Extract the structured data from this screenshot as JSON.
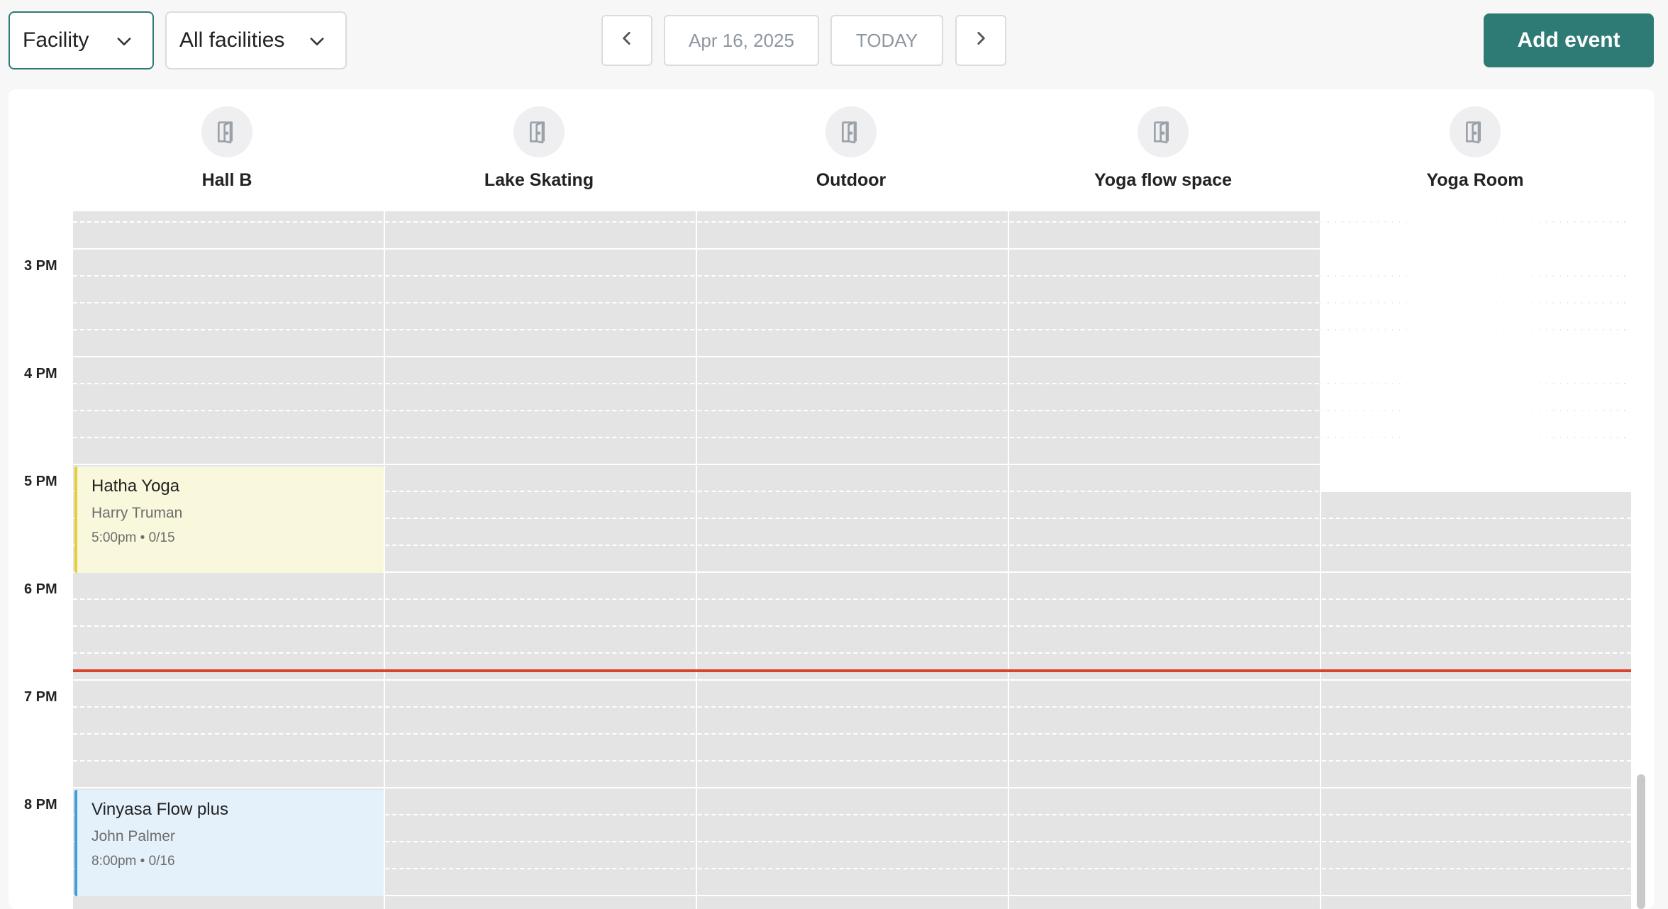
{
  "toolbar": {
    "view_select": "Facility",
    "facility_select": "All facilities",
    "date": "Apr 16, 2025",
    "today": "TODAY",
    "add_event": "Add event"
  },
  "facilities": [
    {
      "name": "Hall B",
      "icon": "door-icon"
    },
    {
      "name": "Lake Skating",
      "icon": "door-icon"
    },
    {
      "name": "Outdoor",
      "icon": "door-icon"
    },
    {
      "name": "Yoga flow space",
      "icon": "door-icon"
    },
    {
      "name": "Yoga Room",
      "icon": "door-icon"
    }
  ],
  "time_labels": [
    "3 PM",
    "4 PM",
    "5 PM",
    "6 PM",
    "7 PM",
    "8 PM"
  ],
  "events": [
    {
      "title": "Hatha Yoga",
      "instructor": "Harry Truman",
      "meta": "5:00pm • 0/15",
      "color": "#e3cf3a",
      "facility": "Hall B"
    },
    {
      "title": "Vinyasa Flow plus",
      "instructor": "John Palmer",
      "meta": "8:00pm • 0/16",
      "color": "#3fa0d6",
      "facility": "Hall B"
    }
  ],
  "colors": {
    "accent": "#2e7a74",
    "now_line": "#d9432c",
    "unavailable": "#e4e4e4"
  }
}
